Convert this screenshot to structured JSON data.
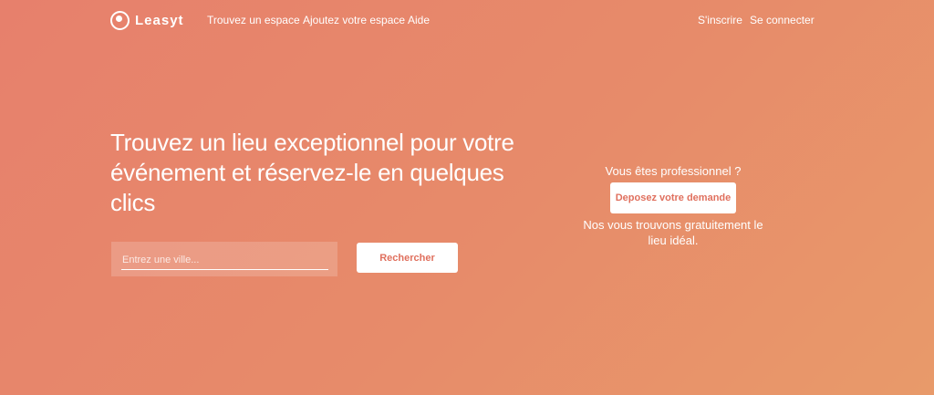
{
  "nav": {
    "brand": "Leasyt",
    "links": {
      "find": "Trouvez un espace",
      "add": "Ajoutez votre espace",
      "help": "Aide"
    },
    "signup": "S'inscrire",
    "login": "Se connecter"
  },
  "hero": {
    "headline": "Trouvez un lieu exceptionnel pour votre événement et réservez-le en quelques clics",
    "search": {
      "placeholder": "Entrez une ville...",
      "value": "",
      "button_label": "Rechercher"
    }
  },
  "pro": {
    "title": "Vous êtes professionnel ?",
    "button_label": "Deposez votre demande",
    "description": "Nos vous trouvons gratuitement le lieu idéal."
  },
  "colors": {
    "background_start": "#e7806c",
    "background_end": "#e89a6a",
    "accent_text": "#e0705e",
    "foreground": "#ffffff"
  },
  "icons": {
    "logo": "brand-logo-icon"
  }
}
